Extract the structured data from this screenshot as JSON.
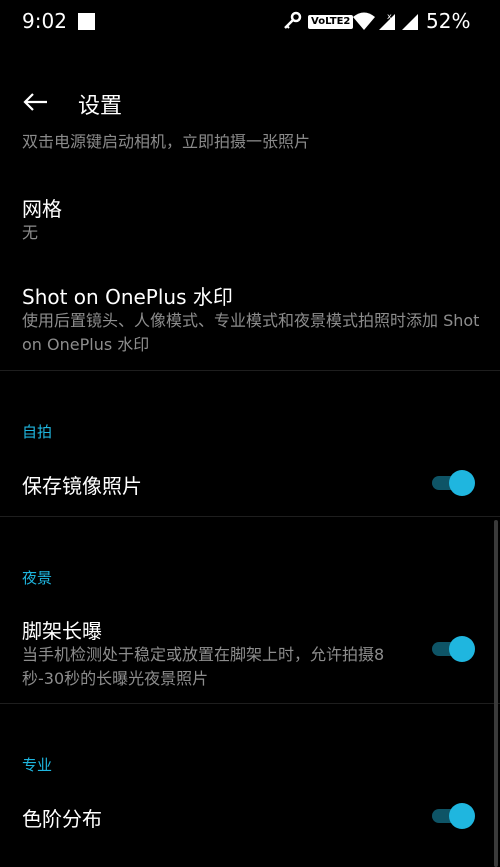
{
  "status_bar": {
    "time": "9:02",
    "volte": "VoLTE2",
    "battery": "52%",
    "icons": [
      "square-notification-icon",
      "key-icon",
      "wifi-icon",
      "signal-icon",
      "signal-icon"
    ]
  },
  "header": {
    "back_icon": "arrow-left-icon",
    "title": "设置"
  },
  "content": {
    "cut_text": "双击电源键启动相机，立即拍摄一张照片",
    "grid": {
      "title": "网格",
      "value": "无"
    },
    "watermark": {
      "title": "Shot on OnePlus 水印",
      "description": "使用后置镜头、人像模式、专业模式和夜景模式拍照时添加 Shot on OnePlus 水印"
    },
    "sections": {
      "selfie": {
        "header": "自拍",
        "item_title": "保存镜像照片",
        "toggle_on": true
      },
      "night": {
        "header": "夜景",
        "item_title": "脚架长曝",
        "item_description": "当手机检测处于稳定或放置在脚架上时，允许拍摄8秒-30秒的长曝光夜景照片",
        "toggle_on": true
      },
      "pro": {
        "header": "专业",
        "item_title": "色阶分布",
        "toggle_on": true
      }
    }
  },
  "colors": {
    "accent": "#1fb6df",
    "track_on": "#0e5466",
    "background": "#000000",
    "secondary_text": "#8d8d8d"
  }
}
